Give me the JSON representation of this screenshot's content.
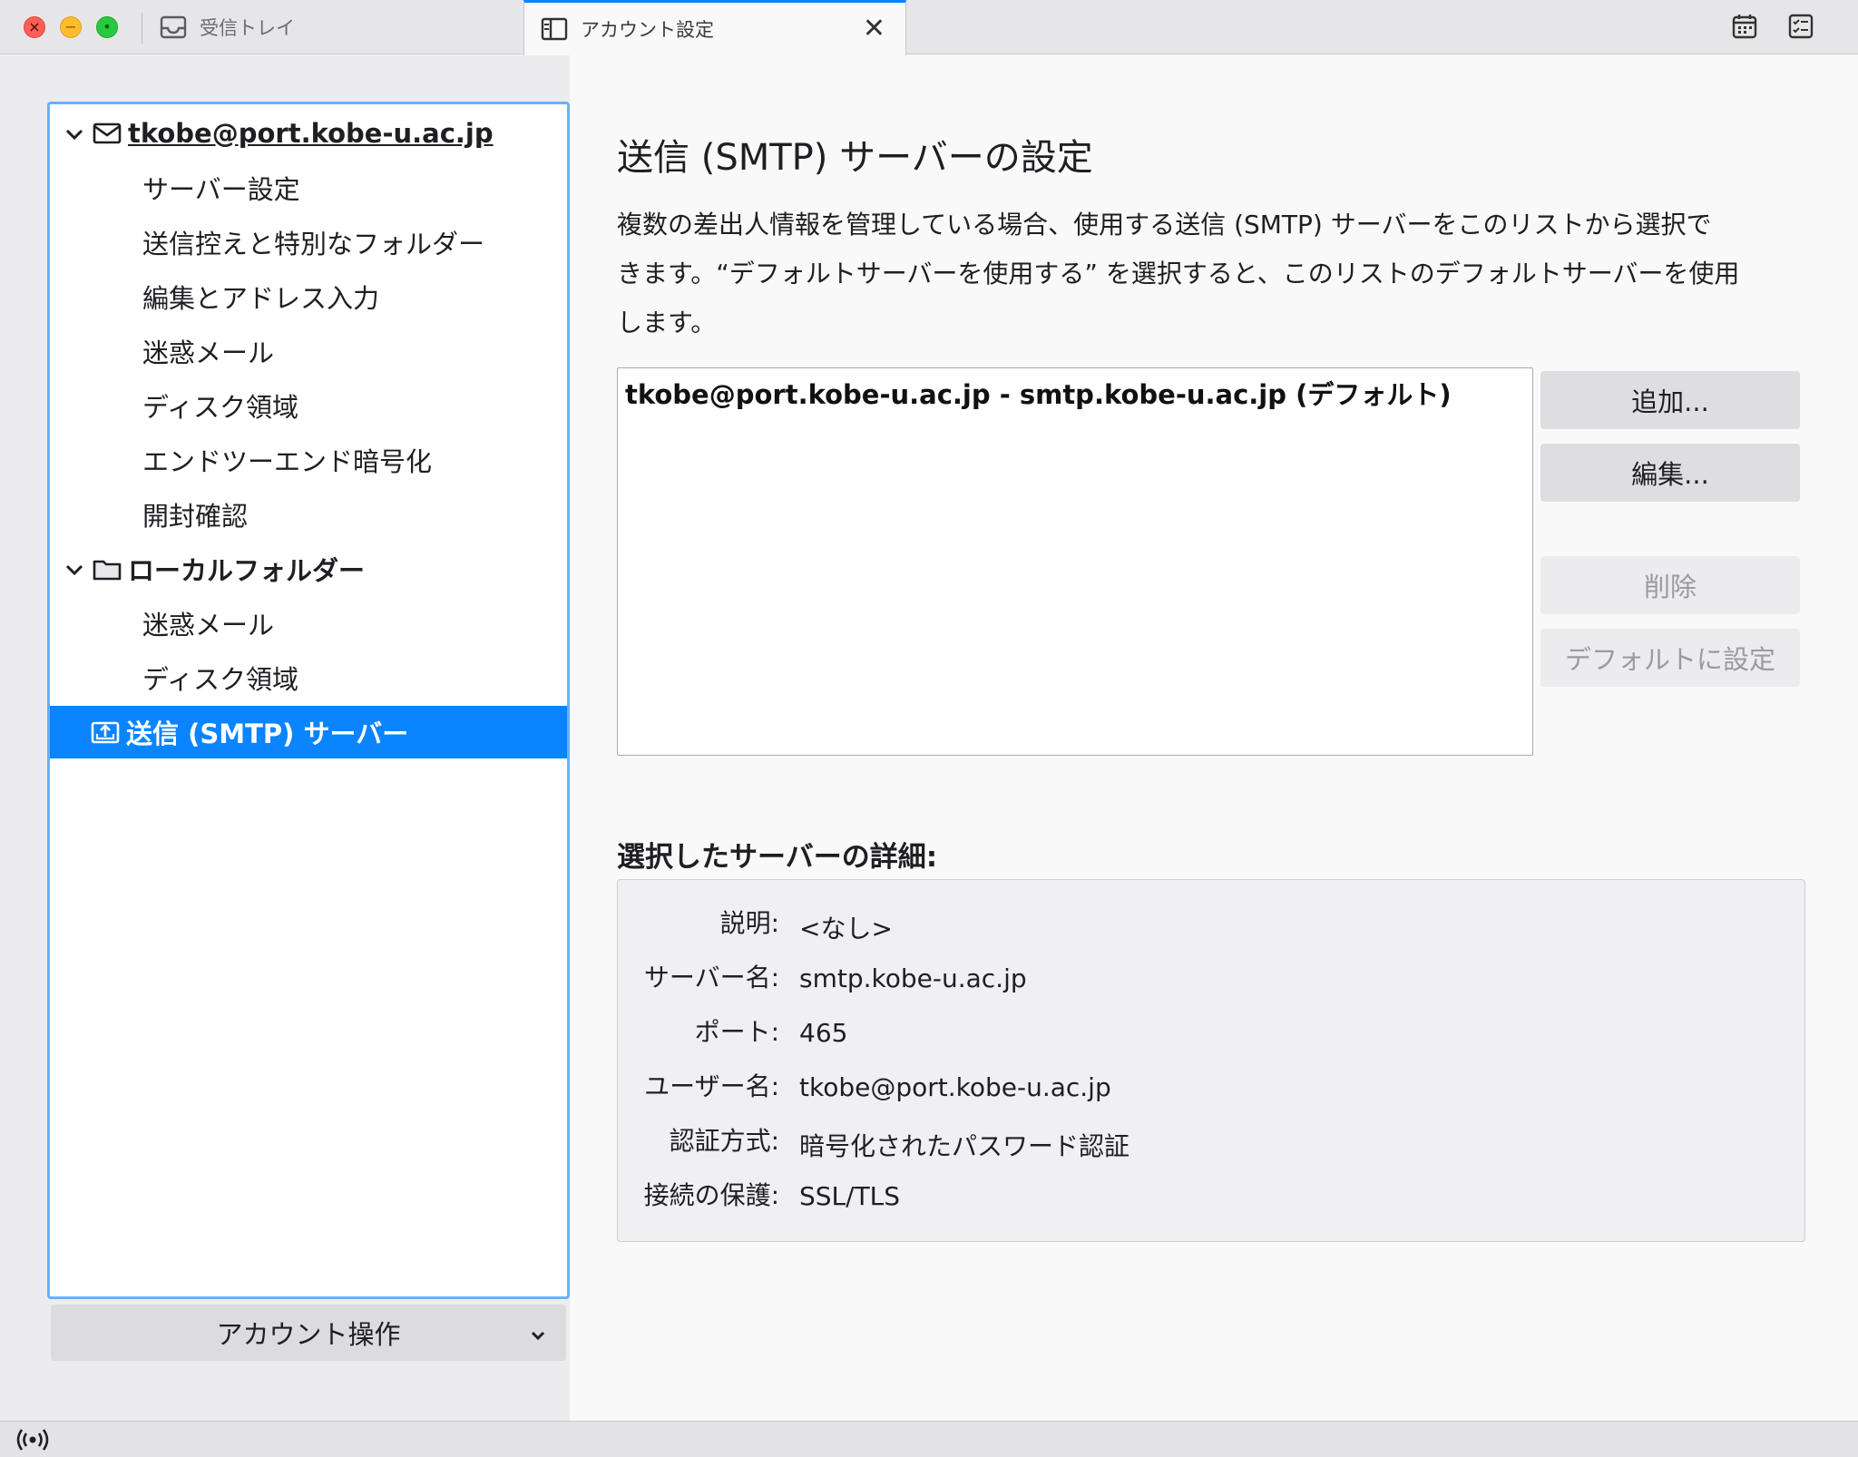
{
  "window": {
    "tabs": [
      {
        "label": "受信トレイ",
        "icon": "inbox-icon",
        "active": false
      },
      {
        "label": "アカウント設定",
        "icon": "account-settings-icon",
        "active": true
      }
    ],
    "close_glyph": "✕",
    "toolbar_icons": [
      "calendar-icon",
      "tasks-icon"
    ]
  },
  "sidebar": {
    "account": {
      "label": "tkobe@port.kobe-u.ac.jp"
    },
    "account_items": [
      {
        "label": "サーバー設定"
      },
      {
        "label": "送信控えと特別なフォルダー"
      },
      {
        "label": "編集とアドレス入力"
      },
      {
        "label": "迷惑メール"
      },
      {
        "label": "ディスク領域"
      },
      {
        "label": "エンドツーエンド暗号化"
      },
      {
        "label": "開封確認"
      }
    ],
    "local_folders": {
      "label": "ローカルフォルダー"
    },
    "local_items": [
      {
        "label": "迷惑メール"
      },
      {
        "label": "ディスク領域"
      }
    ],
    "smtp": {
      "label": "送信 (SMTP) サーバー",
      "selected": true
    },
    "account_actions_label": "アカウント操作"
  },
  "main": {
    "title": "送信 (SMTP) サーバーの設定",
    "description_lines": [
      "複数の差出人情報を管理している場合、使用する送信 (SMTP) サーバーをこのリストから選択で",
      "きます。“デフォルトサーバーを使用する” を選択すると、このリストのデフォルトサーバーを使用",
      "します。"
    ],
    "server_list": [
      "tkobe@port.kobe-u.ac.jp - smtp.kobe-u.ac.jp (デフォルト)"
    ],
    "buttons": {
      "add": "追加...",
      "edit": "編集...",
      "delete": "削除",
      "set_default": "デフォルトに設定"
    },
    "details_title": "選択したサーバーの詳細:",
    "details": [
      {
        "label": "説明:",
        "value": "<なし>"
      },
      {
        "label": "サーバー名:",
        "value": "smtp.kobe-u.ac.jp"
      },
      {
        "label": "ポート:",
        "value": "465"
      },
      {
        "label": "ユーザー名:",
        "value": "tkobe@port.kobe-u.ac.jp"
      },
      {
        "label": "認証方式:",
        "value": "暗号化されたパスワード認証"
      },
      {
        "label": "接続の保護:",
        "value": "SSL/TLS"
      }
    ]
  },
  "colors": {
    "accent": "#0a84ff",
    "focus_ring": "#66b1ff"
  }
}
